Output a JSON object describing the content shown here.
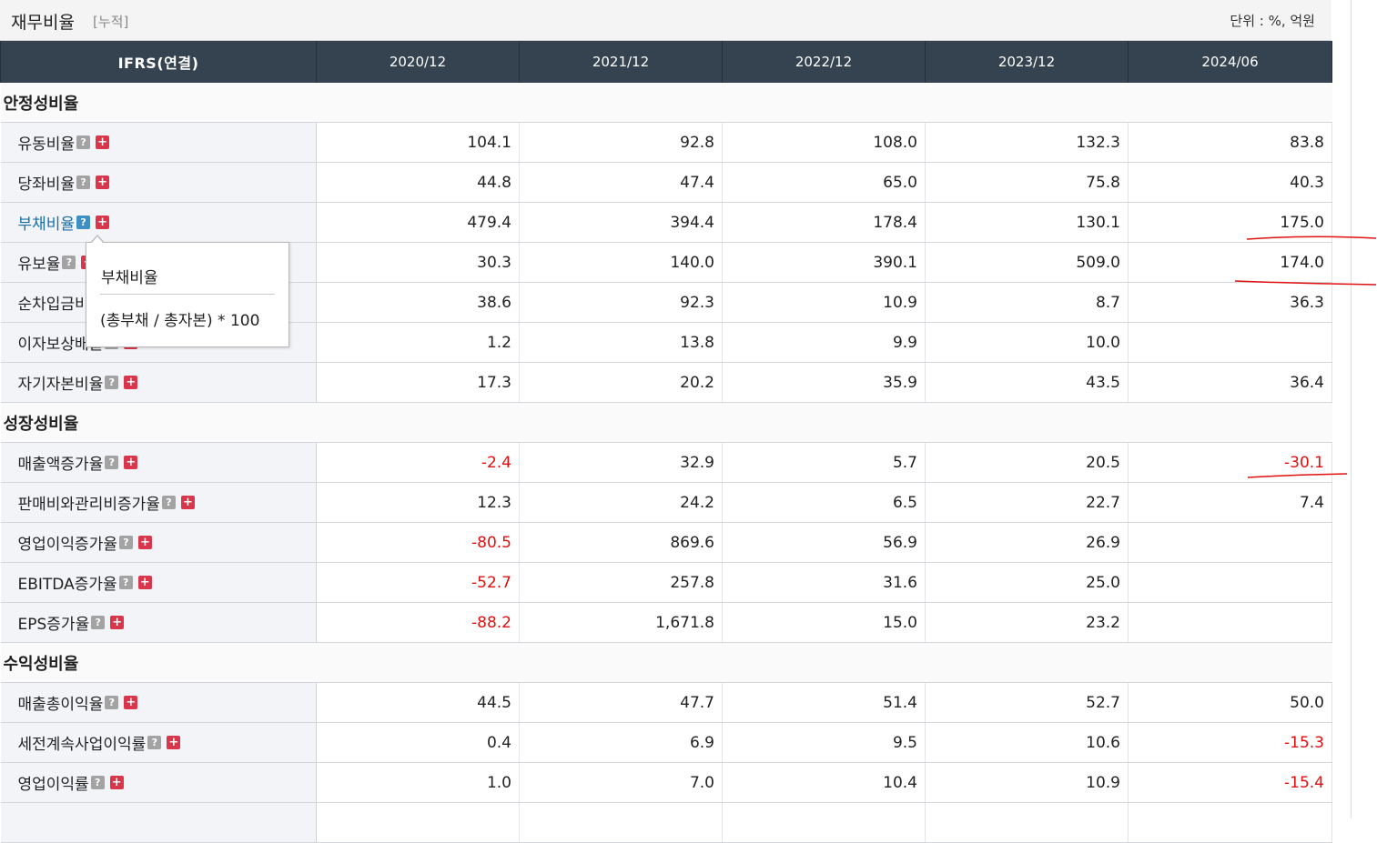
{
  "header": {
    "title": "재무비율",
    "subtitle": "[누적]",
    "unit": "단위 : %, 억원"
  },
  "table": {
    "label_header": "IFRS(연결)",
    "periods": [
      "2020/12",
      "2021/12",
      "2022/12",
      "2023/12",
      "2024/06"
    ],
    "sections": [
      {
        "name": "안정성비율",
        "rows": [
          {
            "label": "유동비율",
            "values": [
              "104.1",
              "92.8",
              "108.0",
              "132.3",
              "83.8"
            ]
          },
          {
            "label": "당좌비율",
            "values": [
              "44.8",
              "47.4",
              "65.0",
              "75.8",
              "40.3"
            ]
          },
          {
            "label": "부채비율",
            "values": [
              "479.4",
              "394.4",
              "178.4",
              "130.1",
              "175.0"
            ],
            "link": true
          },
          {
            "label": "유보율",
            "values": [
              "30.3",
              "140.0",
              "390.1",
              "509.0",
              "174.0"
            ]
          },
          {
            "label": "순차입금비율",
            "values": [
              "38.6",
              "92.3",
              "10.9",
              "8.7",
              "36.3"
            ]
          },
          {
            "label": "이자보상배율",
            "values": [
              "1.2",
              "13.8",
              "9.9",
              "10.0",
              ""
            ]
          },
          {
            "label": "자기자본비율",
            "values": [
              "17.3",
              "20.2",
              "35.9",
              "43.5",
              "36.4"
            ]
          }
        ]
      },
      {
        "name": "성장성비율",
        "rows": [
          {
            "label": "매출액증가율",
            "values": [
              "-2.4",
              "32.9",
              "5.7",
              "20.5",
              "-30.1"
            ]
          },
          {
            "label": "판매비와관리비증가율",
            "values": [
              "12.3",
              "24.2",
              "6.5",
              "22.7",
              "7.4"
            ]
          },
          {
            "label": "영업이익증가율",
            "values": [
              "-80.5",
              "869.6",
              "56.9",
              "26.9",
              ""
            ]
          },
          {
            "label": "EBITDA증가율",
            "values": [
              "-52.7",
              "257.8",
              "31.6",
              "25.0",
              ""
            ]
          },
          {
            "label": "EPS증가율",
            "values": [
              "-88.2",
              "1,671.8",
              "15.0",
              "23.2",
              ""
            ]
          }
        ]
      },
      {
        "name": "수익성비율",
        "rows": [
          {
            "label": "매출총이익율",
            "values": [
              "44.5",
              "47.7",
              "51.4",
              "52.7",
              "50.0"
            ]
          },
          {
            "label": "세전계속사업이익률",
            "values": [
              "0.4",
              "6.9",
              "9.5",
              "10.6",
              "-15.3"
            ]
          },
          {
            "label": "영업이익률",
            "values": [
              "1.0",
              "7.0",
              "10.4",
              "10.9",
              "-15.4"
            ]
          },
          {
            "label": "",
            "values": [
              "",
              "",
              "",
              "",
              ""
            ]
          }
        ]
      }
    ]
  },
  "tooltip": {
    "title": "부채비율",
    "formula": "(총부채 / 총자본) * 100"
  },
  "icons": {
    "help": "question-icon",
    "expand": "plus-icon"
  },
  "colors": {
    "header_bg": "#354350",
    "negative": "#e01010",
    "link": "#1a6fa8",
    "annotation": "#e01010"
  }
}
